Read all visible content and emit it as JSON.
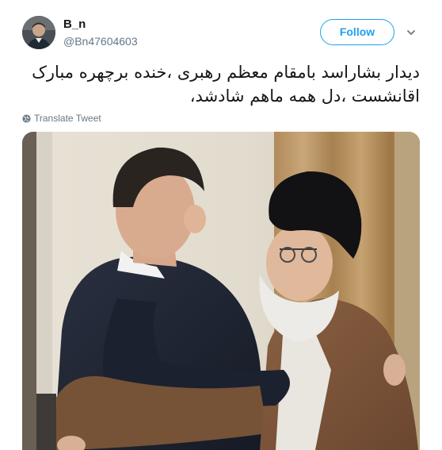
{
  "tweet": {
    "display_name": "B_n",
    "handle": "@Bn47604603",
    "follow_label": "Follow",
    "text_lines": [
      "دیدار بشاراسد بامقام معظم رهبری ،خنده برچهره مبارک",
      "اقانشست ،دل همه ماهم شادشد،"
    ],
    "translate_label": "Translate Tweet"
  },
  "icons": {
    "caret": "chevron-down-icon",
    "translate": "globe-icon"
  },
  "colors": {
    "accent": "#1da1f2",
    "secondary_text": "#657786",
    "primary_text": "#14171a"
  }
}
